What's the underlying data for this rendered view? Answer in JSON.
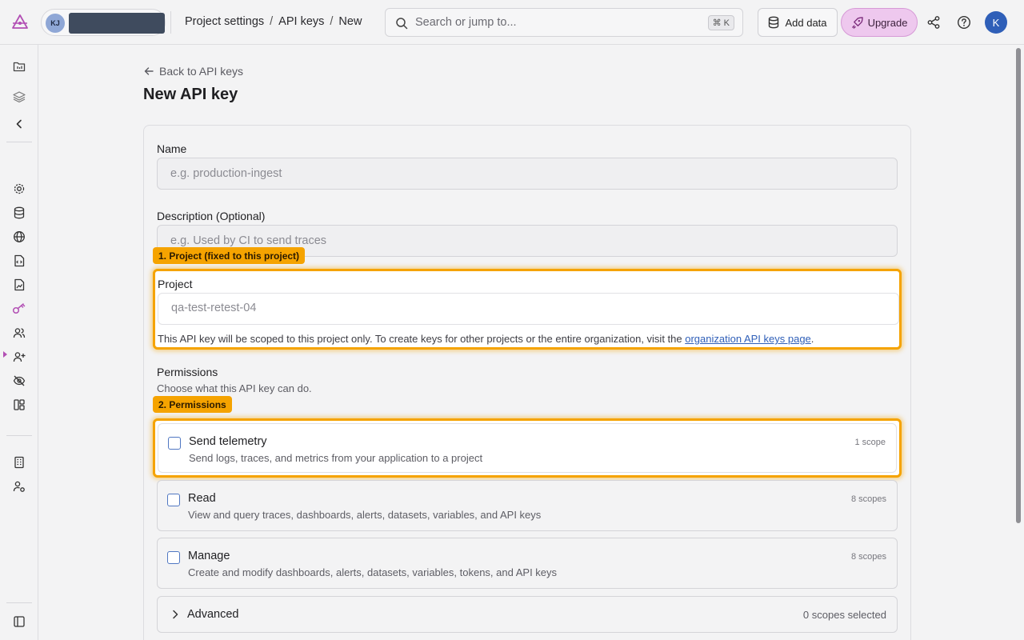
{
  "header": {
    "org_initials": "KJ",
    "breadcrumbs": [
      "Project settings",
      "API keys",
      "New"
    ],
    "search_placeholder": "Search or jump to...",
    "search_shortcut": "⌘ K",
    "add_data_label": "Add data",
    "upgrade_label": "Upgrade",
    "user_initial": "K"
  },
  "sidebar": {
    "items": [
      "folder-icon",
      "layers-icon",
      "collapse-chevron-icon",
      "settings-icon",
      "database-icon",
      "globe-icon",
      "code-file-icon",
      "file-chart-icon",
      "key-icon",
      "users-icon",
      "user-plus-icon",
      "eye-off-icon",
      "layout-icon",
      "building-icon",
      "user-settings-icon",
      "panel-toggle-icon"
    ],
    "active_item": "key-icon",
    "accent_color": "#b24fb4"
  },
  "page": {
    "back_link": "Back to API keys",
    "title": "New API key"
  },
  "form": {
    "name_label": "Name",
    "name_placeholder": "e.g. production-ingest",
    "description_label": "Description (Optional)",
    "description_placeholder": "e.g. Used by CI to send traces",
    "project_tag": "1. Project (fixed to this project)",
    "project_label": "Project",
    "project_value": "qa-test-retest-04",
    "project_help_text": "This API key will be scoped to this project only. To create keys for other projects or the entire organization, visit the ",
    "project_help_link": "organization API keys page",
    "project_help_end": ".",
    "permissions_label": "Permissions",
    "permissions_subtitle": "Choose what this API key can do.",
    "permissions_tag": "2. Permissions",
    "permissions": [
      {
        "title": "Send telemetry",
        "description": "Send logs, traces, and metrics from your application to a project",
        "scope": "1 scope",
        "checked": false
      },
      {
        "title": "Read",
        "description": "View and query traces, dashboards, alerts, datasets, variables, and API keys",
        "scope": "8 scopes",
        "checked": false
      },
      {
        "title": "Manage",
        "description": "Create and modify dashboards, alerts, datasets, variables, tokens, and API keys",
        "scope": "8 scopes",
        "checked": false
      }
    ],
    "advanced_label": "Advanced",
    "advanced_count": "0 scopes selected"
  },
  "colors": {
    "highlight": "#f5a300",
    "upgrade_bg": "#eec8ee",
    "avatar_bg": "#2f5fb8"
  }
}
